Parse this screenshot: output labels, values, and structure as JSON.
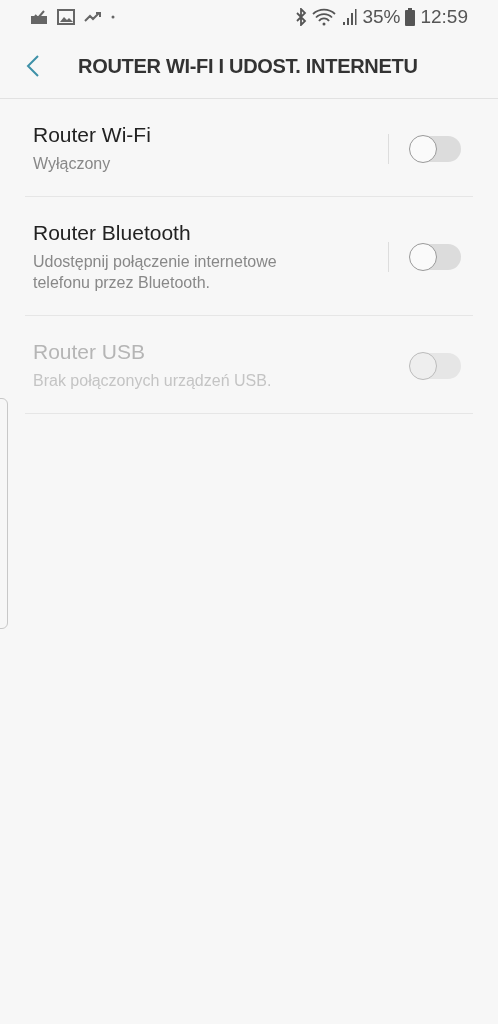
{
  "status_bar": {
    "battery": "35%",
    "time": "12:59"
  },
  "header": {
    "title": "ROUTER WI-FI I UDOST. INTERNETU"
  },
  "rows": [
    {
      "title": "Router Wi-Fi",
      "subtitle": "Wyłączony",
      "on": false,
      "disabled": false
    },
    {
      "title": "Router Bluetooth",
      "subtitle": "Udostępnij połączenie internetowe telefonu przez Bluetooth.",
      "on": false,
      "disabled": false
    },
    {
      "title": "Router USB",
      "subtitle": "Brak połączonych urządzeń USB.",
      "on": false,
      "disabled": true
    }
  ]
}
